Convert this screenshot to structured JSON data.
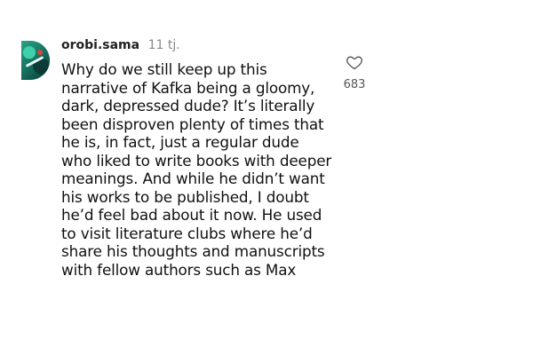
{
  "comment": {
    "username": "orobi.sama",
    "time": "11 tj.",
    "text": "Why do we still keep up this narrative of Kafka being a gloomy, dark, depressed dude? It’s literally been disproven plenty of times that he is, in fact, just a regular dude who liked to write books with deeper meanings. And while he didn’t want his works to be published, I doubt he’d feel bad about it now. He used to visit literature clubs where he’d share his thoughts and manuscripts with fellow authors such as Max",
    "like_icon": "heart-outline-icon",
    "like_count": "683"
  },
  "colors": {
    "text": "#111111",
    "username": "#222222",
    "muted": "#8a8a8a",
    "avatar": "#1e7f6d"
  }
}
